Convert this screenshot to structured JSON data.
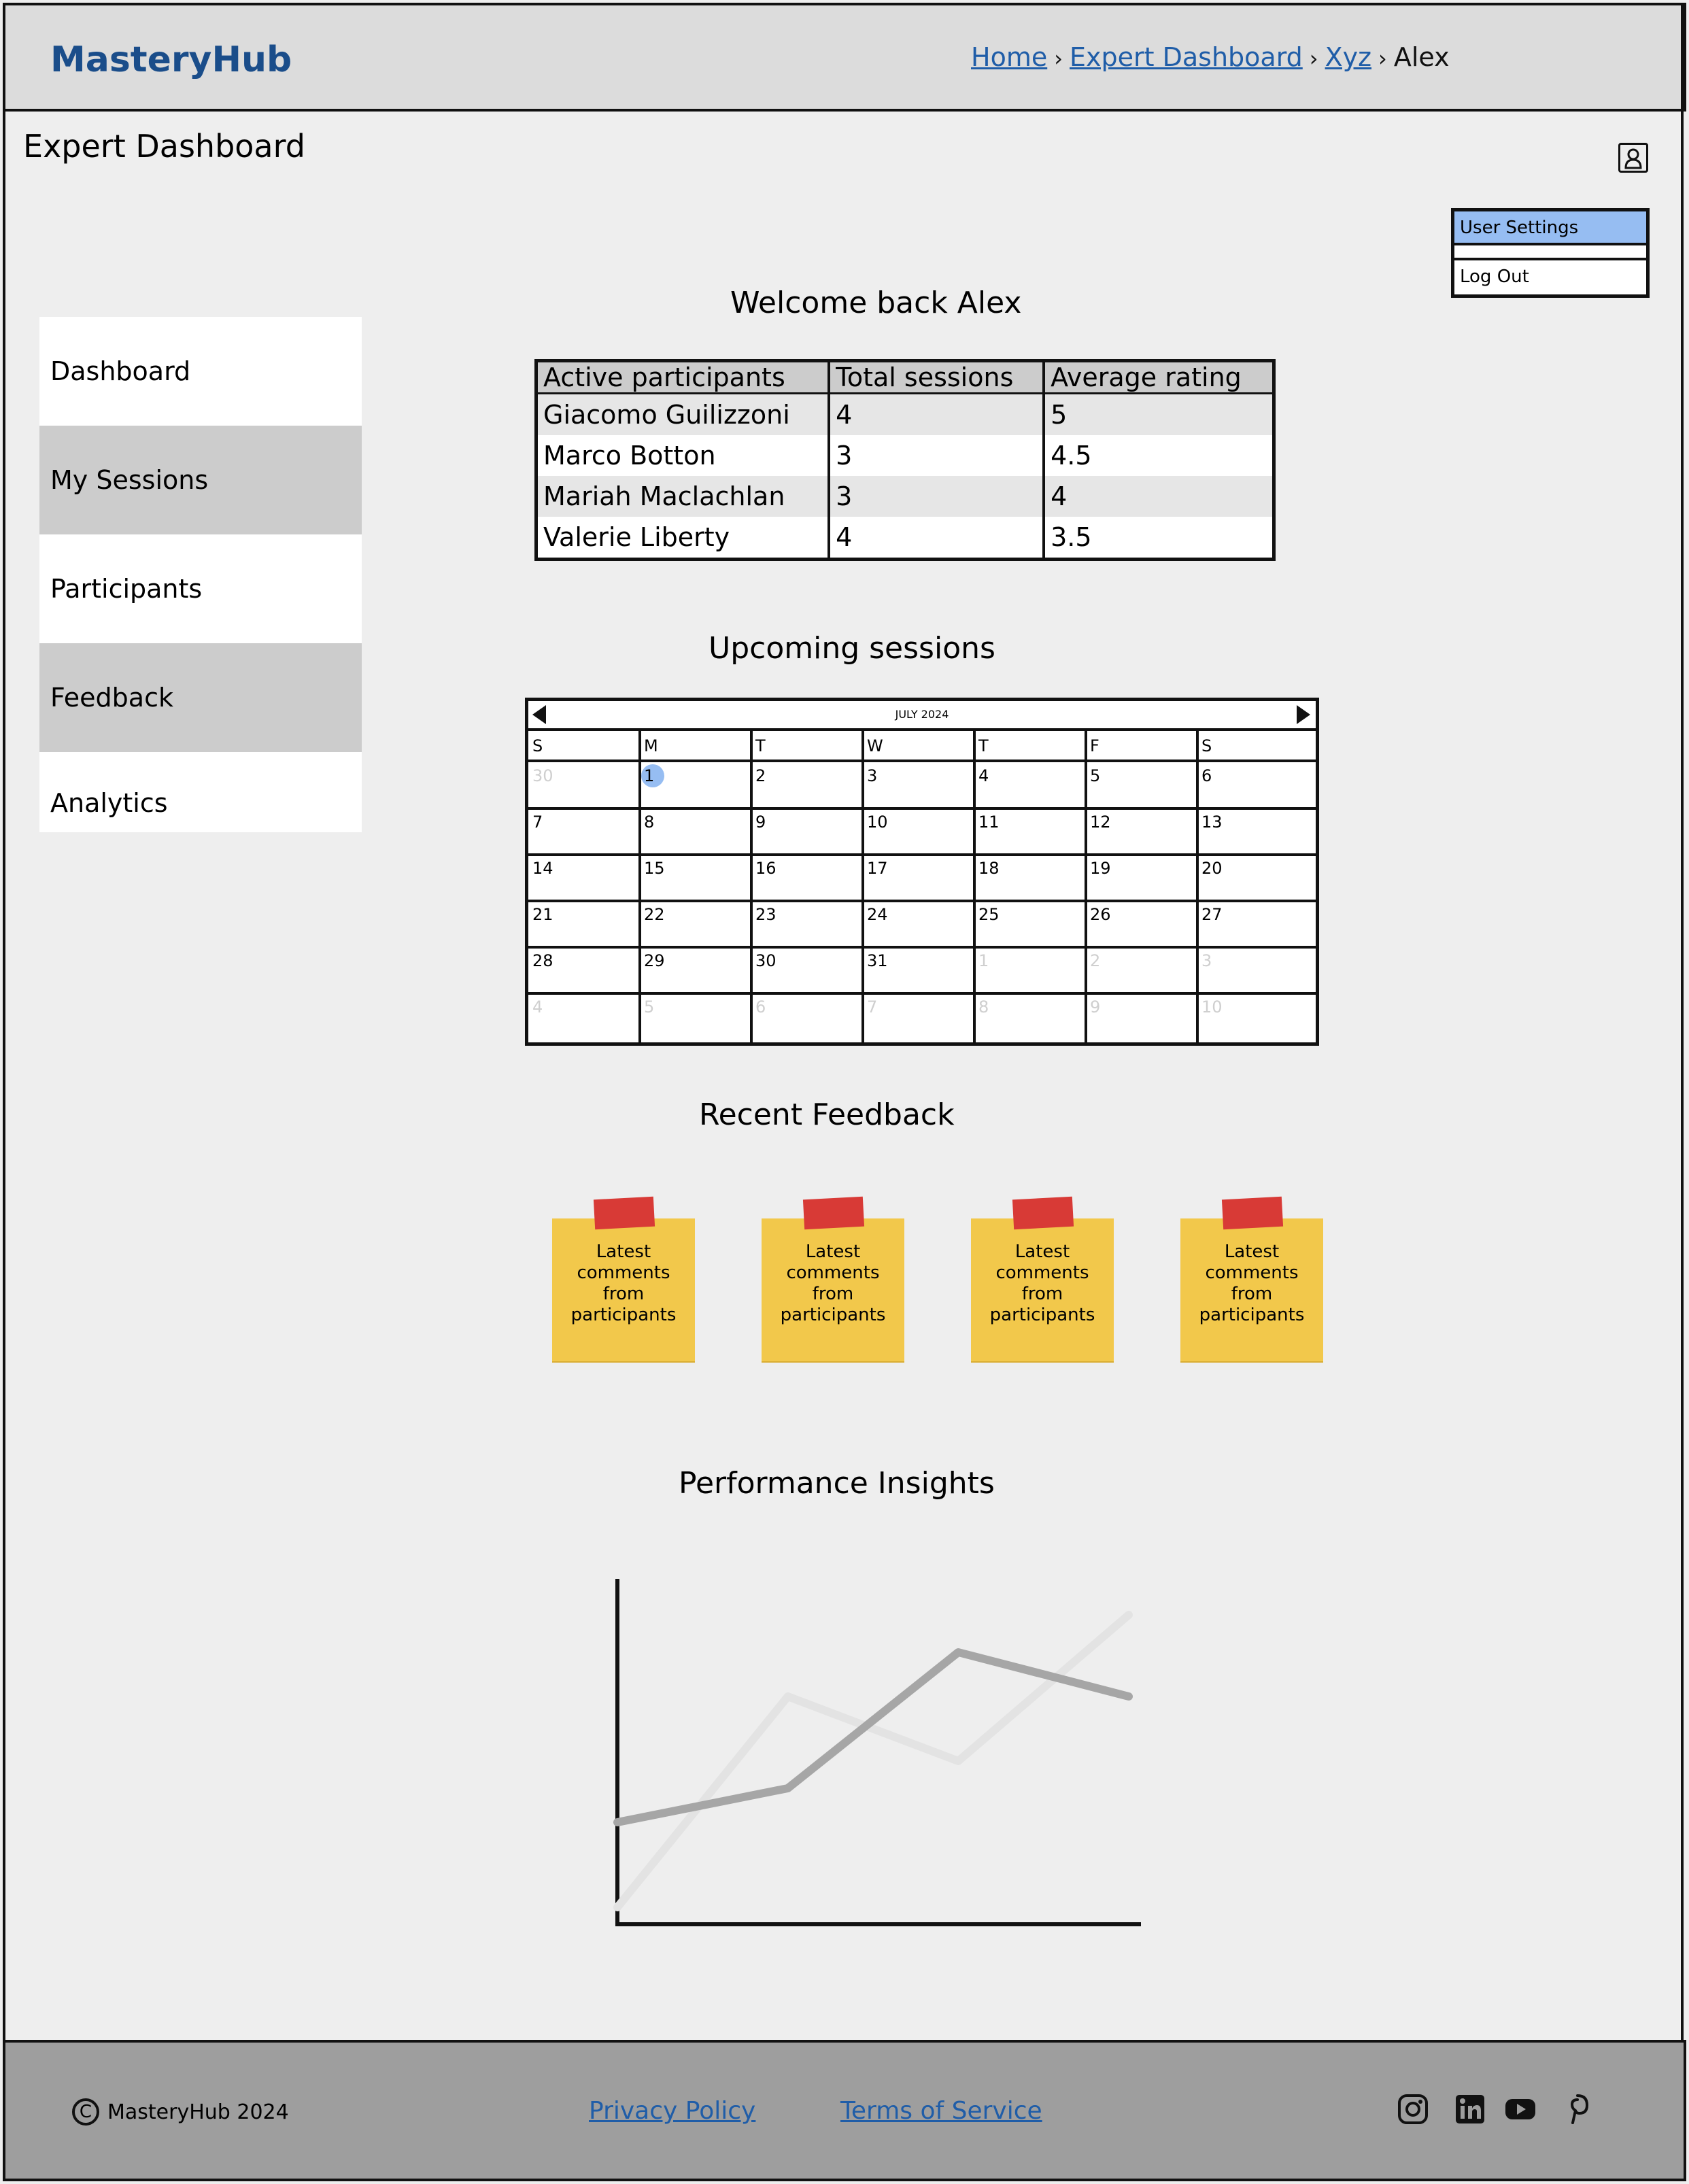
{
  "header": {
    "logo": "MasteryHub",
    "breadcrumb": {
      "home": "Home",
      "expert_dashboard": "Expert Dashboard",
      "xyz": "Xyz",
      "current": "Alex"
    }
  },
  "page": {
    "title": "Expert Dashboard"
  },
  "user_menu": {
    "settings": "User Settings",
    "logout": "Log Out"
  },
  "sidebar": {
    "items": [
      {
        "label": "Dashboard"
      },
      {
        "label": "My Sessions"
      },
      {
        "label": "Participants"
      },
      {
        "label": "Feedback"
      },
      {
        "label": "Analytics"
      }
    ]
  },
  "welcome": {
    "heading": "Welcome back Alex"
  },
  "participants_table": {
    "headers": [
      "Active participants",
      "Total sessions",
      "Average rating"
    ],
    "rows": [
      [
        "Giacomo Guilizzoni",
        "4",
        "5"
      ],
      [
        "Marco Botton",
        "3",
        "4.5"
      ],
      [
        "Mariah Maclachlan",
        "3",
        "4"
      ],
      [
        "Valerie Liberty",
        "4",
        "3.5"
      ]
    ]
  },
  "calendar": {
    "heading": "Upcoming sessions",
    "month": "JULY 2024",
    "weekdays": [
      "S",
      "M",
      "T",
      "W",
      "T",
      "F",
      "S"
    ],
    "weeks": [
      [
        "30",
        "1",
        "2",
        "3",
        "4",
        "5",
        "6"
      ],
      [
        "7",
        "8",
        "9",
        "10",
        "11",
        "12",
        "13"
      ],
      [
        "14",
        "15",
        "16",
        "17",
        "18",
        "19",
        "20"
      ],
      [
        "21",
        "22",
        "23",
        "24",
        "25",
        "26",
        "27"
      ],
      [
        "28",
        "29",
        "30",
        "31",
        "1",
        "2",
        "3"
      ],
      [
        "4",
        "5",
        "6",
        "7",
        "8",
        "9",
        "10"
      ]
    ],
    "selected_day": "1"
  },
  "feedback": {
    "heading": "Recent Feedback",
    "notes": [
      {
        "text": "Latest comments from participants"
      },
      {
        "text": "Latest comments from participants"
      },
      {
        "text": "Latest comments from participants"
      },
      {
        "text": "Latest comments from participants"
      }
    ],
    "note_color": "#f2c84b",
    "tape_color": "#d83a36"
  },
  "insights": {
    "heading": "Performance Insights"
  },
  "chart_data": {
    "type": "line",
    "title": "",
    "xlabel": "",
    "ylabel": "",
    "x": [
      0,
      1,
      2,
      3
    ],
    "series": [
      {
        "values": [
          0.3,
          0.4,
          0.8,
          0.67
        ],
        "color": "#a6a6a6"
      },
      {
        "values": [
          0.05,
          0.67,
          0.48,
          0.91
        ],
        "color": "#e3e3e3"
      }
    ],
    "ylim": [
      0,
      1
    ]
  },
  "footer": {
    "copyright": "MasteryHub 2024",
    "privacy": "Privacy Policy",
    "terms": "Terms of Service",
    "social_icons": [
      "instagram-icon",
      "linkedin-icon",
      "youtube-icon",
      "pinterest-icon"
    ]
  },
  "colors": {
    "brand": "#1a4d8a",
    "link": "#1f5da8",
    "highlight": "#96bdf2",
    "header_bg": "#dcdcdc",
    "footer_bg": "#9e9e9e"
  }
}
